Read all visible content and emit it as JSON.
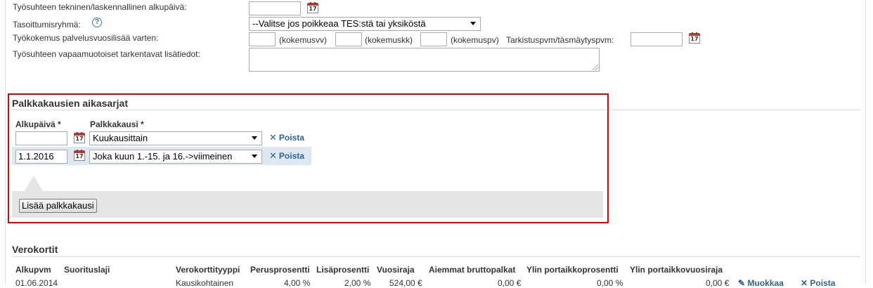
{
  "employment": {
    "start_date_label": "Työsuhteen tekninen/laskennallinen alkupäivä:",
    "start_date_value": "",
    "leveling_group_label": "Tasoittumisryhmä:",
    "leveling_group_selected": "--Valitse jos poikkeaa TES:stä tai yksiköstä",
    "experience_label": "Työkokemus palvelusvuosilisää varten:",
    "exp_years_value": "",
    "exp_years_unit": "(kokemusvv)",
    "exp_months_value": "",
    "exp_months_unit": "(kokemuskk)",
    "exp_days_value": "",
    "exp_days_unit": "(kokemuspv)",
    "check_date_label": "Tarkistuspvm/täsmäytyspvm:",
    "check_date_value": "",
    "extra_info_label": "Työsuhteen vapaamuotoiset tarkentavat lisätiedot:",
    "extra_info_value": ""
  },
  "pay_periods": {
    "title": "Palkkakausien aikasarjat",
    "col_start": "Alkupäivä *",
    "col_period": "Palkkakausi *",
    "rows": [
      {
        "start": "",
        "period": "Kuukausittain",
        "remove": "Poista"
      },
      {
        "start": "1.1.2016",
        "period": "Joka kuun 1.-15. ja 16.->viimeinen",
        "remove": "Poista"
      }
    ],
    "add_button": "Lisää palkkakausi"
  },
  "tax_cards": {
    "title": "Verokortit",
    "headers": [
      "Alkupvm",
      "Suorituslaji",
      "Verokorttityyppi",
      "Perusprosentti",
      "Lisäprosentti",
      "Vuosiraja",
      "Aiemmat bruttopalkat",
      "Ylin portaikkoprosentti",
      "Ylin portaikkovuosiraja"
    ],
    "row": {
      "start": "01.06.2014",
      "type": "Kausikohtainen",
      "base_pct": "4,00 %",
      "extra_pct": "2,00 %",
      "year_limit": "524,00 €",
      "prev_gross": "0,00 €",
      "top_pct": "0,00 %",
      "top_limit": "0,00 €",
      "edit": "Muokkaa",
      "remove": "Poista"
    }
  },
  "colors": {
    "highlight_border": "#e00000",
    "link": "#2a6496",
    "row_highlight": "#dde8f2",
    "panel": "#e5e5e5"
  }
}
